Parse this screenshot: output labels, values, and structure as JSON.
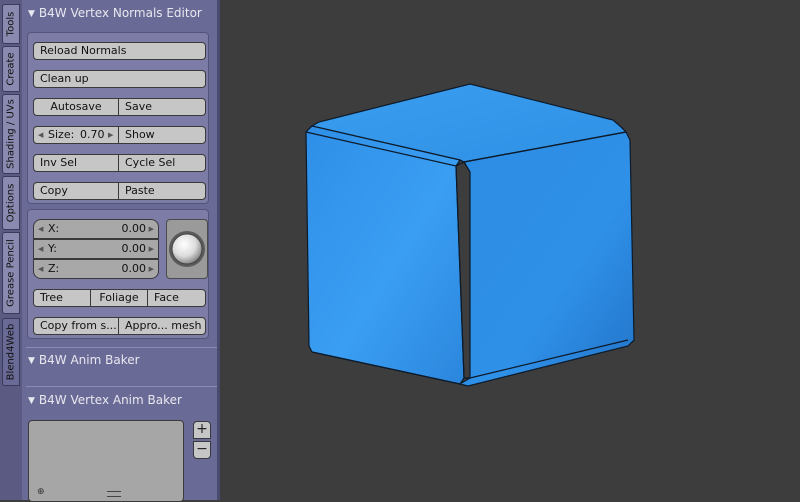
{
  "tabs": [
    "Tools",
    "Create",
    "Shading / UVs",
    "Options",
    "Grease Pencil",
    "Blend4Web"
  ],
  "panels": {
    "normals_editor": {
      "title": "B4W Vertex Normals Editor",
      "reload_normals": "Reload Normals",
      "clean_up": "Clean up",
      "autosave": "Autosave",
      "save": "Save",
      "size_label": "Size:",
      "size_value": "0.70",
      "show": "Show",
      "inv_sel": "Inv Sel",
      "cycle_sel": "Cycle Sel",
      "copy": "Copy",
      "paste": "Paste",
      "x_label": "X:",
      "x_value": "0.00",
      "y_label": "Y:",
      "y_value": "0.00",
      "z_label": "Z:",
      "z_value": "0.00",
      "tree": "Tree",
      "foliage": "Foliage",
      "face": "Face",
      "copy_from": "Copy from s...",
      "approx_mesh": "Appro... mesh"
    },
    "anim_baker": {
      "title": "B4W Anim Baker"
    },
    "vertex_anim_baker": {
      "title": "B4W Vertex Anim Baker",
      "add_symbol": "+",
      "remove_symbol": "−"
    }
  },
  "viewport": {
    "object": "cube",
    "object_color": "#2f8fe8"
  },
  "colors": {
    "panel_bg": "#6a6a96",
    "viewport_bg": "#3d3d3d",
    "button_bg": "#c6c6c6"
  }
}
